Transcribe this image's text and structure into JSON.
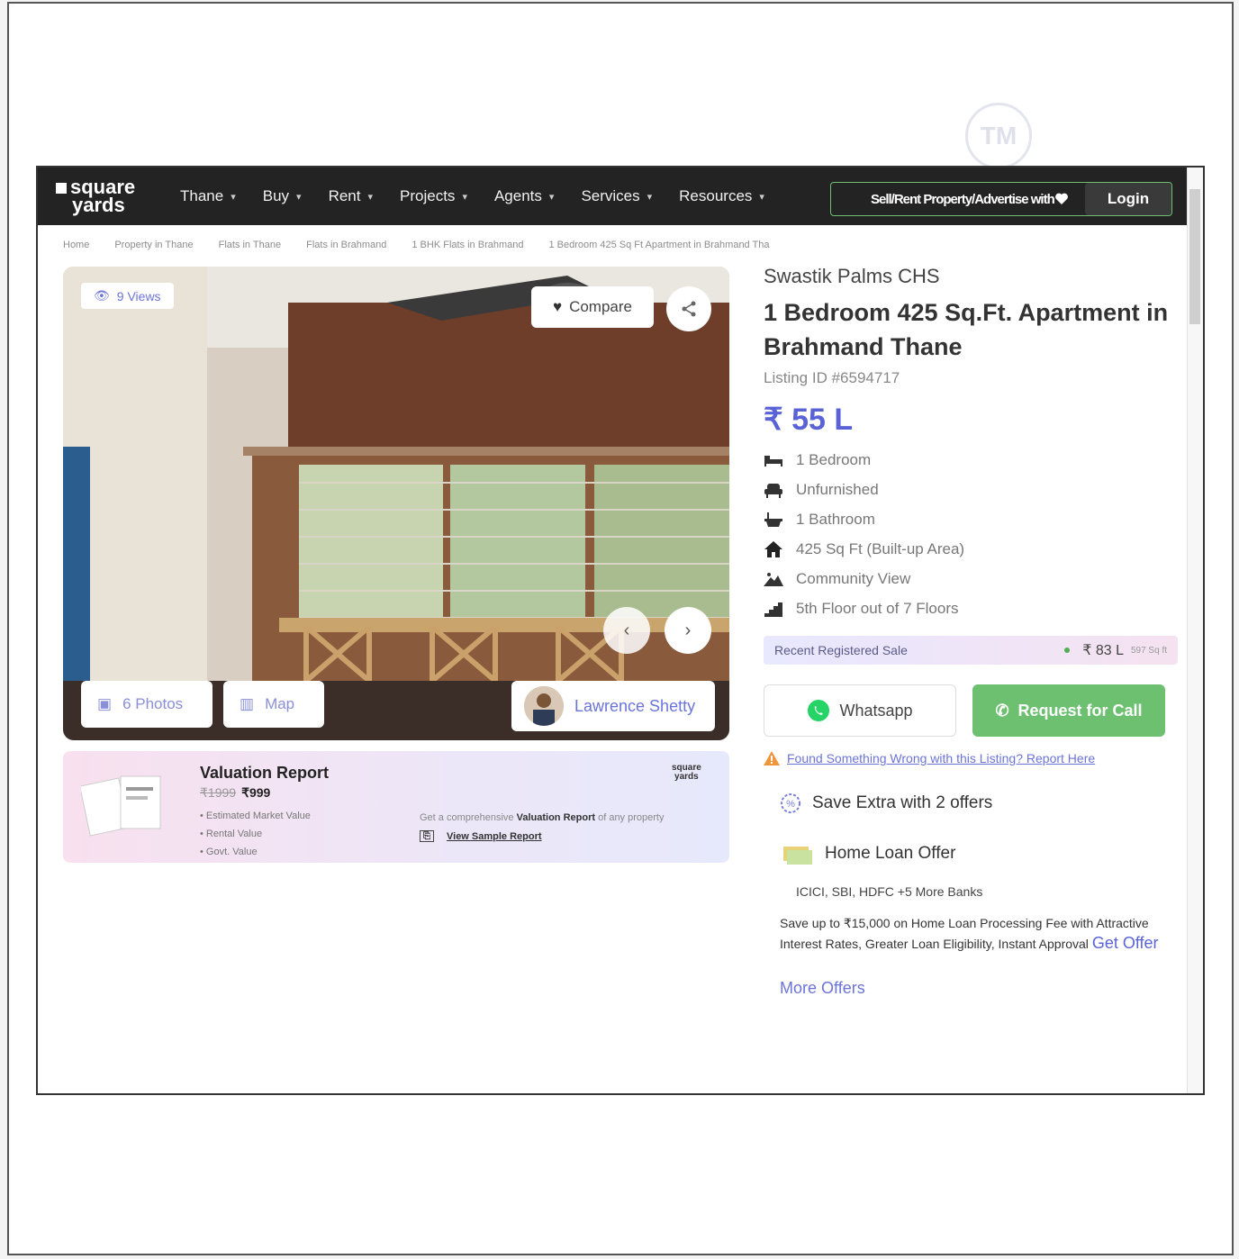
{
  "nav": {
    "logo_line1": "square",
    "logo_line2": "yards",
    "items": [
      "Thane",
      "Buy",
      "Rent",
      "Projects",
      "Agents",
      "Services",
      "Resources"
    ],
    "overlay_text": "Sell/Rent Property/Advertise with",
    "login_label": "Login"
  },
  "breadcrumb": [
    "Home",
    "Property in Thane",
    "Flats in Thane",
    "Flats in Brahmand",
    "1 BHK Flats in Brahmand",
    "1 Bedroom 425 Sq Ft Apartment in Brahmand Tha"
  ],
  "gallery": {
    "views_label": "9 Views",
    "compare_label": "Compare",
    "photos_label": "6 Photos",
    "map_label": "Map",
    "agent_name": "Lawrence Shetty"
  },
  "valuation": {
    "title": "Valuation Report",
    "old_price": "₹1999",
    "price": "₹999",
    "bullets": [
      "Estimated Market Value",
      "Rental Value",
      "Govt. Value"
    ],
    "desc_prefix": "Get a comprehensive",
    "desc_bold": "Valuation Report",
    "desc_suffix": "of any property",
    "sample_label": "View Sample Report",
    "brand_line1": "square",
    "brand_line2": "yards"
  },
  "listing": {
    "society": "Swastik Palms CHS",
    "title": "1 Bedroom 425 Sq.Ft. Apartment in Brahmand Thane",
    "listing_id": "Listing ID #6594717",
    "price": "₹ 55 L",
    "features": [
      {
        "icon": "bed-icon",
        "label": "1 Bedroom"
      },
      {
        "icon": "sofa-icon",
        "label": "Unfurnished"
      },
      {
        "icon": "bathtub-icon",
        "label": "1 Bathroom"
      },
      {
        "icon": "home-icon",
        "label": "425 Sq Ft  (Built-up Area)"
      },
      {
        "icon": "view-icon",
        "label": "Community View"
      },
      {
        "icon": "floor-icon",
        "label": "5th Floor out of 7 Floors"
      }
    ],
    "recent_sale_label": "Recent Registered Sale",
    "recent_sale_value": "₹ 83 L",
    "recent_sale_unit": "597 Sq ft",
    "whatsapp_label": "Whatsapp",
    "call_label": "Request for Call",
    "report_link": "Found Something Wrong with this Listing? Report Here",
    "offers_title": "Save Extra with 2 offers",
    "home_loan_title": "Home Loan Offer",
    "banks": "ICICI, SBI, HDFC +5 More Banks",
    "loan_desc": "Save up to ₹15,000 on Home Loan Processing Fee with Attractive Interest Rates, Greater Loan Eligibility, Instant Approval",
    "get_offer": "Get Offer",
    "more_offers": "More Offers"
  },
  "colors": {
    "nav_bg": "#232323",
    "accent": "#5a63d6",
    "call_green": "#6cc06f",
    "whatsapp_green": "#25d366"
  }
}
